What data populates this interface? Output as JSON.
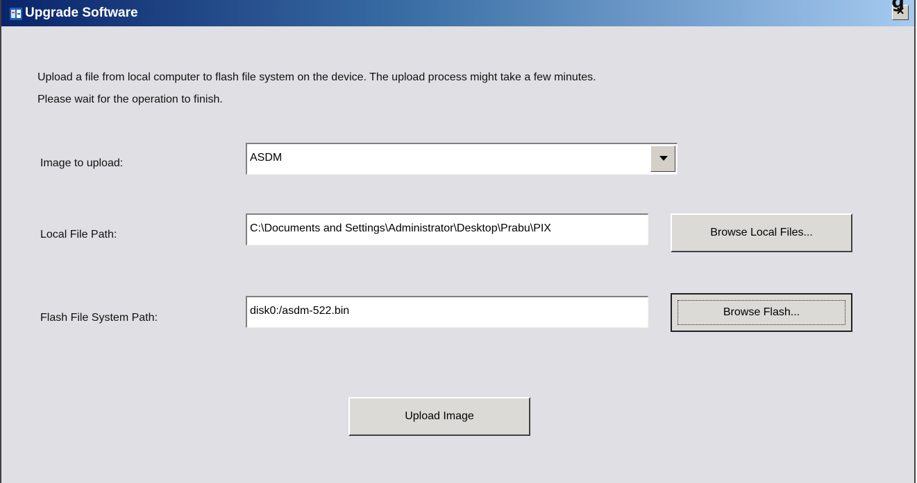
{
  "window": {
    "title": "Upgrade Software",
    "close_label": "×",
    "corner_mark": "ɡ",
    "icon": "app-icon"
  },
  "description": {
    "line1": "Upload a file from local computer to flash file system on the device. The upload process might take a few minutes.",
    "line2": "Please wait for the operation to finish."
  },
  "image_to_upload": {
    "label": "Image to upload:",
    "value": "ASDM",
    "icon": "chevron-down-icon"
  },
  "local_file_path": {
    "label": "Local File Path:",
    "value": "C:\\Documents and Settings\\Administrator\\Desktop\\Prabu\\PIX",
    "button": "Browse Local Files..."
  },
  "flash_file_path": {
    "label": "Flash File System Path:",
    "value": "disk0:/asdm-522.bin",
    "button": "Browse Flash..."
  },
  "upload_button": "Upload Image"
}
